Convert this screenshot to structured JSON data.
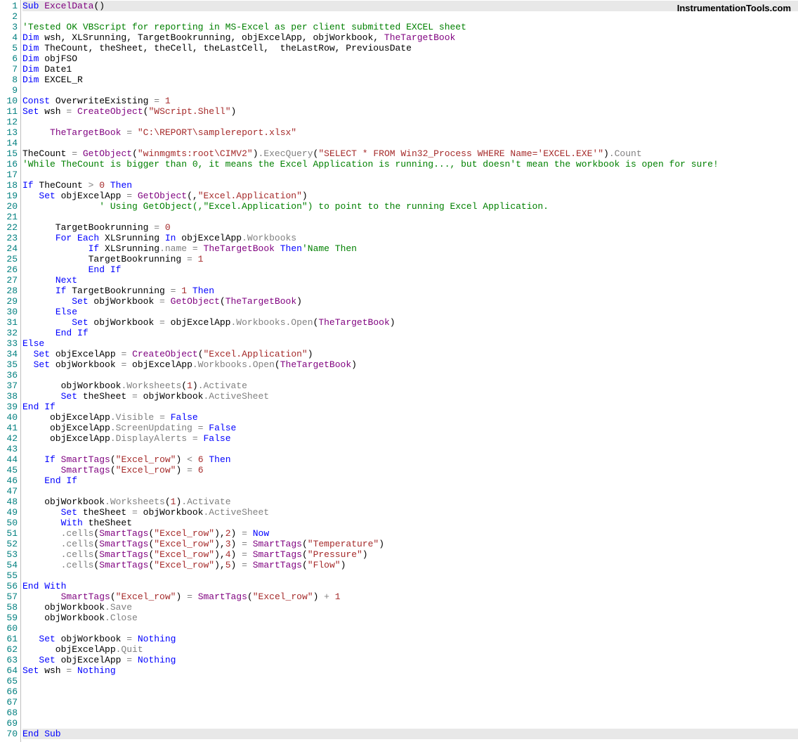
{
  "watermark": "InstrumentationTools.com",
  "highlighted_lines": [
    1,
    70
  ],
  "total_lines": 70,
  "lines": [
    [
      [
        "kw",
        "Sub "
      ],
      [
        "fn",
        "ExcelData"
      ],
      [
        "",
        ""
      ],
      [
        "",
        "()"
      ]
    ],
    [
      [
        "",
        ""
      ]
    ],
    [
      [
        "cm",
        "'Tested OK VBScript for reporting in MS-Excel as per client submitted EXCEL sheet"
      ]
    ],
    [
      [
        "kw",
        "Dim"
      ],
      [
        "",
        " wsh, XLSrunning, TargetBookrunning, objExcelApp, objWorkbook, "
      ],
      [
        "fn",
        "TheTargetBook"
      ]
    ],
    [
      [
        "kw",
        "Dim"
      ],
      [
        "",
        " TheCount, theSheet, theCell, theLastCell,  theLastRow, PreviousDate"
      ]
    ],
    [
      [
        "kw",
        "Dim"
      ],
      [
        "",
        " objFSO"
      ]
    ],
    [
      [
        "kw",
        "Dim"
      ],
      [
        "",
        " Date1"
      ]
    ],
    [
      [
        "kw",
        "Dim"
      ],
      [
        "",
        " EXCEL_R"
      ]
    ],
    [
      [
        "",
        ""
      ]
    ],
    [
      [
        "kw",
        "Const"
      ],
      [
        "",
        " OverwriteExisting "
      ],
      [
        "eq",
        "="
      ],
      [
        "",
        " "
      ],
      [
        "nm",
        "1"
      ]
    ],
    [
      [
        "kw",
        "Set"
      ],
      [
        "",
        " wsh "
      ],
      [
        "eq",
        "="
      ],
      [
        "",
        " "
      ],
      [
        "fn",
        "CreateObject"
      ],
      [
        "",
        "("
      ],
      [
        "st",
        "\"WScript.Shell\""
      ],
      [
        "",
        ")"
      ]
    ],
    [
      [
        "",
        ""
      ]
    ],
    [
      [
        "",
        "     "
      ],
      [
        "fn",
        "TheTargetBook"
      ],
      [
        "",
        " "
      ],
      [
        "eq",
        "="
      ],
      [
        "",
        " "
      ],
      [
        "st",
        "\"C:\\REPORT\\samplereport.xlsx\""
      ]
    ],
    [
      [
        "",
        ""
      ]
    ],
    [
      [
        "",
        "TheCount "
      ],
      [
        "eq",
        "="
      ],
      [
        "",
        " "
      ],
      [
        "fn",
        "GetObject"
      ],
      [
        "",
        "("
      ],
      [
        "st",
        "\"winmgmts:root\\CIMV2\""
      ],
      [
        "",
        ")"
      ],
      [
        "at",
        ".ExecQuery"
      ],
      [
        "",
        "("
      ],
      [
        "st",
        "\"SELECT * FROM Win32_Process WHERE Name='EXCEL.EXE'\""
      ],
      [
        "",
        ")"
      ],
      [
        "at",
        ".Count"
      ]
    ],
    [
      [
        "cm",
        "'While TheCount is bigger than 0, it means the Excel Application is running..., but doesn't mean the workbook is open for sure!"
      ]
    ],
    [
      [
        "",
        ""
      ]
    ],
    [
      [
        "kw",
        "If"
      ],
      [
        "",
        " TheCount "
      ],
      [
        "eq",
        ">"
      ],
      [
        "",
        " "
      ],
      [
        "nm",
        "0"
      ],
      [
        "",
        " "
      ],
      [
        "kw",
        "Then"
      ]
    ],
    [
      [
        "",
        "   "
      ],
      [
        "kw",
        "Set"
      ],
      [
        "",
        " objExcelApp "
      ],
      [
        "eq",
        "="
      ],
      [
        "",
        " "
      ],
      [
        "fn",
        "GetObject"
      ],
      [
        "",
        "(,"
      ],
      [
        "st",
        "\"Excel.Application\""
      ],
      [
        "",
        ")"
      ]
    ],
    [
      [
        "",
        "              "
      ],
      [
        "cm",
        "' Using GetObject(,\"Excel.Application\") to point to the running Excel Application."
      ]
    ],
    [
      [
        "",
        ""
      ]
    ],
    [
      [
        "",
        "      TargetBookrunning "
      ],
      [
        "eq",
        "="
      ],
      [
        "",
        " "
      ],
      [
        "nm",
        "0"
      ]
    ],
    [
      [
        "",
        "      "
      ],
      [
        "kw",
        "For Each"
      ],
      [
        "",
        " XLSrunning "
      ],
      [
        "kw",
        "In"
      ],
      [
        "",
        " objExcelApp"
      ],
      [
        "at",
        ".Workbooks"
      ]
    ],
    [
      [
        "",
        "            "
      ],
      [
        "kw",
        "If"
      ],
      [
        "",
        " XLSrunning"
      ],
      [
        "at",
        ".name"
      ],
      [
        "",
        " "
      ],
      [
        "eq",
        "="
      ],
      [
        "",
        " "
      ],
      [
        "fn",
        "TheTargetBook"
      ],
      [
        "",
        " "
      ],
      [
        "kw",
        "Then"
      ],
      [
        "cm",
        "'Name Then"
      ]
    ],
    [
      [
        "",
        "            TargetBookrunning "
      ],
      [
        "eq",
        "="
      ],
      [
        "",
        " "
      ],
      [
        "nm",
        "1"
      ]
    ],
    [
      [
        "",
        "            "
      ],
      [
        "kw",
        "End If"
      ]
    ],
    [
      [
        "",
        "      "
      ],
      [
        "kw",
        "Next"
      ]
    ],
    [
      [
        "",
        "      "
      ],
      [
        "kw",
        "If"
      ],
      [
        "",
        " TargetBookrunning "
      ],
      [
        "eq",
        "="
      ],
      [
        "",
        " "
      ],
      [
        "nm",
        "1"
      ],
      [
        "",
        " "
      ],
      [
        "kw",
        "Then"
      ]
    ],
    [
      [
        "",
        "         "
      ],
      [
        "kw",
        "Set"
      ],
      [
        "",
        " objWorkbook "
      ],
      [
        "eq",
        "="
      ],
      [
        "",
        " "
      ],
      [
        "fn",
        "GetObject"
      ],
      [
        "",
        "("
      ],
      [
        "fn",
        "TheTargetBook"
      ],
      [
        "",
        ")"
      ]
    ],
    [
      [
        "",
        "      "
      ],
      [
        "kw",
        "Else"
      ]
    ],
    [
      [
        "",
        "         "
      ],
      [
        "kw",
        "Set"
      ],
      [
        "",
        " objWorkbook "
      ],
      [
        "eq",
        "="
      ],
      [
        "",
        " objExcelApp"
      ],
      [
        "at",
        ".Workbooks.Open"
      ],
      [
        "",
        "("
      ],
      [
        "fn",
        "TheTargetBook"
      ],
      [
        "",
        ")"
      ]
    ],
    [
      [
        "",
        "      "
      ],
      [
        "kw",
        "End If"
      ]
    ],
    [
      [
        "kw",
        "Else"
      ]
    ],
    [
      [
        "",
        "  "
      ],
      [
        "kw",
        "Set"
      ],
      [
        "",
        " objExcelApp "
      ],
      [
        "eq",
        "="
      ],
      [
        "",
        " "
      ],
      [
        "fn",
        "CreateObject"
      ],
      [
        "",
        "("
      ],
      [
        "st",
        "\"Excel.Application\""
      ],
      [
        "",
        ")"
      ]
    ],
    [
      [
        "",
        "  "
      ],
      [
        "kw",
        "Set"
      ],
      [
        "",
        " objWorkbook "
      ],
      [
        "eq",
        "="
      ],
      [
        "",
        " objExcelApp"
      ],
      [
        "at",
        ".Workbooks.Open"
      ],
      [
        "",
        "("
      ],
      [
        "fn",
        "TheTargetBook"
      ],
      [
        "",
        ")"
      ]
    ],
    [
      [
        "",
        ""
      ]
    ],
    [
      [
        "",
        "       objWorkbook"
      ],
      [
        "at",
        ".Worksheets"
      ],
      [
        "",
        "("
      ],
      [
        "nm",
        "1"
      ],
      [
        "",
        ")"
      ],
      [
        "at",
        ".Activate"
      ]
    ],
    [
      [
        "",
        "       "
      ],
      [
        "kw",
        "Set"
      ],
      [
        "",
        " theSheet "
      ],
      [
        "eq",
        "="
      ],
      [
        "",
        " objWorkbook"
      ],
      [
        "at",
        ".ActiveSheet"
      ]
    ],
    [
      [
        "kw",
        "End If"
      ]
    ],
    [
      [
        "",
        "     objExcelApp"
      ],
      [
        "at",
        ".Visible"
      ],
      [
        "",
        " "
      ],
      [
        "eq",
        "="
      ],
      [
        "",
        " "
      ],
      [
        "kw",
        "False"
      ]
    ],
    [
      [
        "",
        "     objExcelApp"
      ],
      [
        "at",
        ".ScreenUpdating"
      ],
      [
        "",
        " "
      ],
      [
        "eq",
        "="
      ],
      [
        "",
        " "
      ],
      [
        "kw",
        "False"
      ]
    ],
    [
      [
        "",
        "     objExcelApp"
      ],
      [
        "at",
        ".DisplayAlerts"
      ],
      [
        "",
        " "
      ],
      [
        "eq",
        "="
      ],
      [
        "",
        " "
      ],
      [
        "kw",
        "False"
      ]
    ],
    [
      [
        "",
        ""
      ]
    ],
    [
      [
        "",
        "    "
      ],
      [
        "kw",
        "If"
      ],
      [
        "",
        " "
      ],
      [
        "fn",
        "SmartTags"
      ],
      [
        "",
        "("
      ],
      [
        "st",
        "\"Excel_row\""
      ],
      [
        "",
        ") "
      ],
      [
        "eq",
        "<"
      ],
      [
        "",
        " "
      ],
      [
        "nm",
        "6"
      ],
      [
        "",
        " "
      ],
      [
        "kw",
        "Then"
      ]
    ],
    [
      [
        "",
        "       "
      ],
      [
        "fn",
        "SmartTags"
      ],
      [
        "",
        "("
      ],
      [
        "st",
        "\"Excel_row\""
      ],
      [
        "",
        ") "
      ],
      [
        "eq",
        "="
      ],
      [
        "",
        " "
      ],
      [
        "nm",
        "6"
      ]
    ],
    [
      [
        "",
        "    "
      ],
      [
        "kw",
        "End If"
      ]
    ],
    [
      [
        "",
        ""
      ]
    ],
    [
      [
        "",
        "    objWorkbook"
      ],
      [
        "at",
        ".Worksheets"
      ],
      [
        "",
        "("
      ],
      [
        "nm",
        "1"
      ],
      [
        "",
        ")"
      ],
      [
        "at",
        ".Activate"
      ]
    ],
    [
      [
        "",
        "       "
      ],
      [
        "kw",
        "Set"
      ],
      [
        "",
        " theSheet "
      ],
      [
        "eq",
        "="
      ],
      [
        "",
        " objWorkbook"
      ],
      [
        "at",
        ".ActiveSheet"
      ]
    ],
    [
      [
        "",
        "       "
      ],
      [
        "kw",
        "With"
      ],
      [
        "",
        " theSheet"
      ]
    ],
    [
      [
        "",
        "       "
      ],
      [
        "at",
        ".cells"
      ],
      [
        "",
        "("
      ],
      [
        "fn",
        "SmartTags"
      ],
      [
        "",
        "("
      ],
      [
        "st",
        "\"Excel_row\""
      ],
      [
        "",
        "),"
      ],
      [
        "nm",
        "2"
      ],
      [
        "",
        ") "
      ],
      [
        "eq",
        "="
      ],
      [
        "",
        " "
      ],
      [
        "kw",
        "Now"
      ]
    ],
    [
      [
        "",
        "       "
      ],
      [
        "at",
        ".cells"
      ],
      [
        "",
        "("
      ],
      [
        "fn",
        "SmartTags"
      ],
      [
        "",
        "("
      ],
      [
        "st",
        "\"Excel_row\""
      ],
      [
        "",
        "),"
      ],
      [
        "nm",
        "3"
      ],
      [
        "",
        ") "
      ],
      [
        "eq",
        "="
      ],
      [
        "",
        " "
      ],
      [
        "fn",
        "SmartTags"
      ],
      [
        "",
        "("
      ],
      [
        "st",
        "\"Temperature\""
      ],
      [
        "",
        ")"
      ]
    ],
    [
      [
        "",
        "       "
      ],
      [
        "at",
        ".cells"
      ],
      [
        "",
        "("
      ],
      [
        "fn",
        "SmartTags"
      ],
      [
        "",
        "("
      ],
      [
        "st",
        "\"Excel_row\""
      ],
      [
        "",
        "),"
      ],
      [
        "nm",
        "4"
      ],
      [
        "",
        ") "
      ],
      [
        "eq",
        "="
      ],
      [
        "",
        " "
      ],
      [
        "fn",
        "SmartTags"
      ],
      [
        "",
        "("
      ],
      [
        "st",
        "\"Pressure\""
      ],
      [
        "",
        ")"
      ]
    ],
    [
      [
        "",
        "       "
      ],
      [
        "at",
        ".cells"
      ],
      [
        "",
        "("
      ],
      [
        "fn",
        "SmartTags"
      ],
      [
        "",
        "("
      ],
      [
        "st",
        "\"Excel_row\""
      ],
      [
        "",
        "),"
      ],
      [
        "nm",
        "5"
      ],
      [
        "",
        ") "
      ],
      [
        "eq",
        "="
      ],
      [
        "",
        " "
      ],
      [
        "fn",
        "SmartTags"
      ],
      [
        "",
        "("
      ],
      [
        "st",
        "\"Flow\""
      ],
      [
        "",
        ")"
      ]
    ],
    [
      [
        "",
        ""
      ]
    ],
    [
      [
        "kw",
        "End With"
      ]
    ],
    [
      [
        "",
        "       "
      ],
      [
        "fn",
        "SmartTags"
      ],
      [
        "",
        "("
      ],
      [
        "st",
        "\"Excel_row\""
      ],
      [
        "",
        ") "
      ],
      [
        "eq",
        "="
      ],
      [
        "",
        " "
      ],
      [
        "fn",
        "SmartTags"
      ],
      [
        "",
        "("
      ],
      [
        "st",
        "\"Excel_row\""
      ],
      [
        "",
        ") "
      ],
      [
        "eq",
        "+"
      ],
      [
        "",
        " "
      ],
      [
        "nm",
        "1"
      ]
    ],
    [
      [
        "",
        "    objWorkbook"
      ],
      [
        "at",
        ".Save"
      ]
    ],
    [
      [
        "",
        "    objWorkbook"
      ],
      [
        "at",
        ".Close"
      ]
    ],
    [
      [
        "",
        ""
      ]
    ],
    [
      [
        "",
        "   "
      ],
      [
        "kw",
        "Set"
      ],
      [
        "",
        " objWorkbook "
      ],
      [
        "eq",
        "="
      ],
      [
        "",
        " "
      ],
      [
        "kw",
        "Nothing"
      ]
    ],
    [
      [
        "",
        "      objExcelApp"
      ],
      [
        "at",
        ".Quit"
      ]
    ],
    [
      [
        "",
        "   "
      ],
      [
        "kw",
        "Set"
      ],
      [
        "",
        " objExcelApp "
      ],
      [
        "eq",
        "="
      ],
      [
        "",
        " "
      ],
      [
        "kw",
        "Nothing"
      ]
    ],
    [
      [
        "kw",
        "Set"
      ],
      [
        "",
        " wsh "
      ],
      [
        "eq",
        "="
      ],
      [
        "",
        " "
      ],
      [
        "kw",
        "Nothing"
      ]
    ],
    [
      [
        "",
        ""
      ]
    ],
    [
      [
        "",
        ""
      ]
    ],
    [
      [
        "",
        ""
      ]
    ],
    [
      [
        "",
        ""
      ]
    ],
    [
      [
        "",
        ""
      ]
    ],
    [
      [
        "kw",
        "End Sub"
      ]
    ]
  ]
}
